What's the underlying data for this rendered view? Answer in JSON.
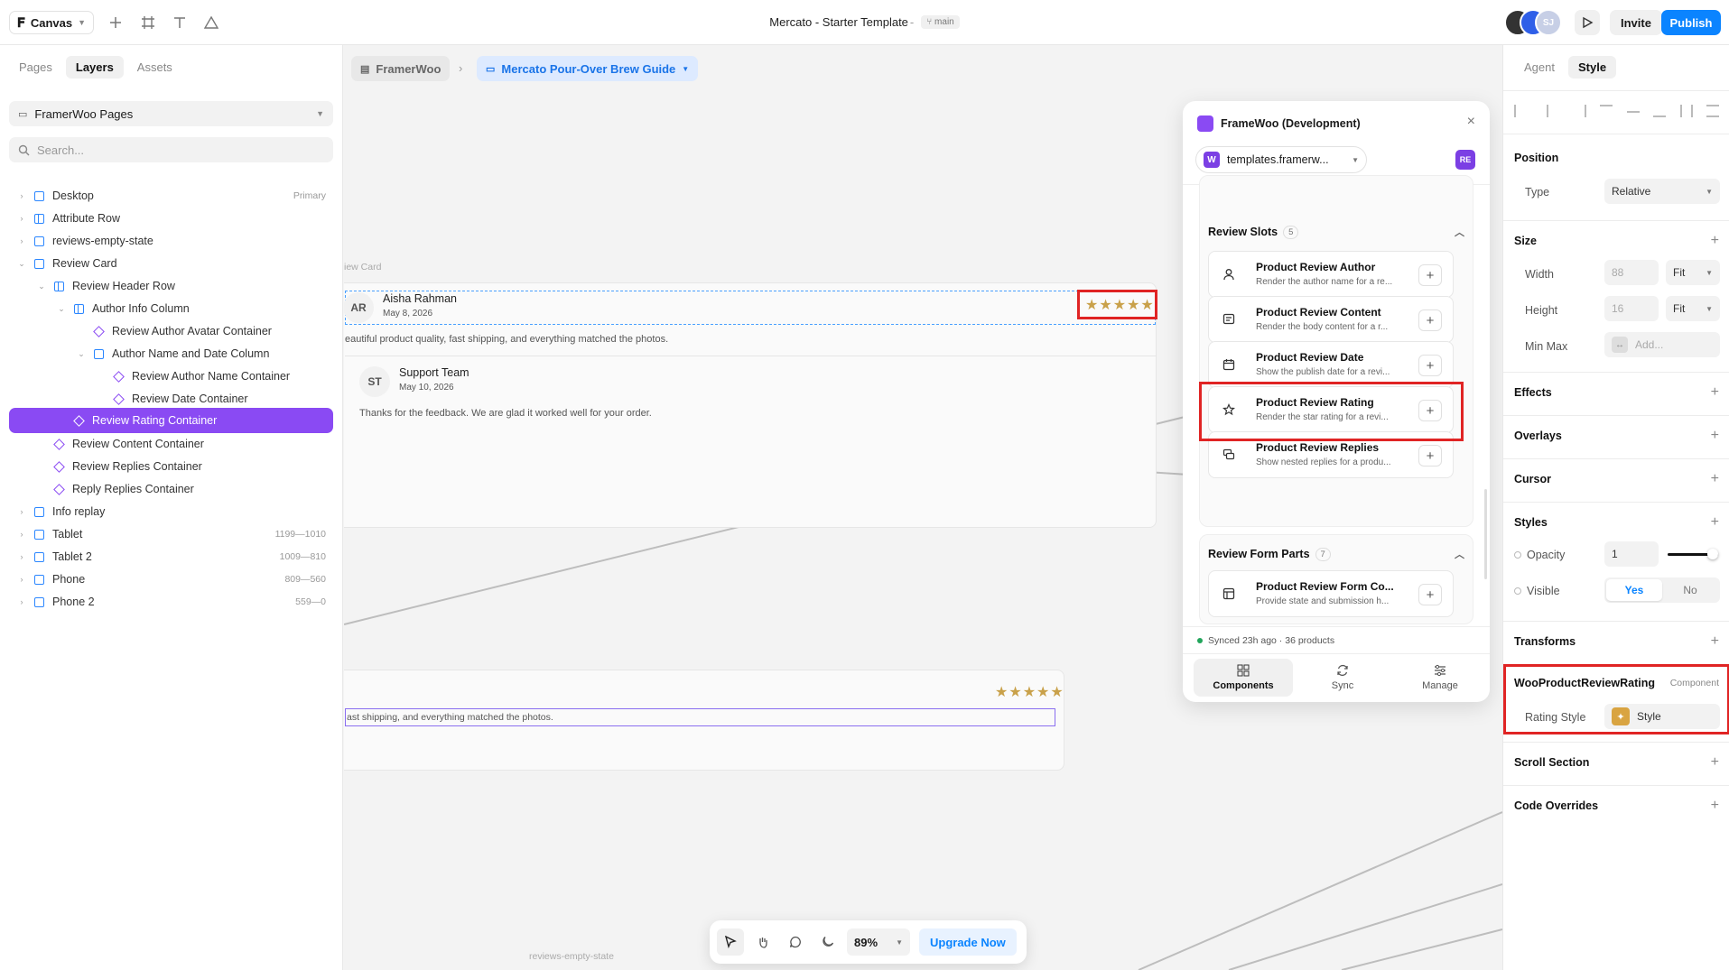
{
  "topbar": {
    "canvas_label": "Canvas",
    "title": "Mercato - Starter Template",
    "title_sep": "-",
    "branch": "main",
    "avatar_initials": "SJ",
    "invite_label": "Invite",
    "publish_label": "Publish"
  },
  "left_panel": {
    "tabs": [
      "Pages",
      "Layers",
      "Assets"
    ],
    "active_tab": "Layers",
    "page_selector": "FramerWoo Pages",
    "search_placeholder": "Search...",
    "layers": [
      {
        "label": "Desktop",
        "meta": "Primary"
      },
      {
        "label": "Attribute Row",
        "meta": ""
      },
      {
        "label": "reviews-empty-state",
        "meta": ""
      },
      {
        "label": "Review Card",
        "meta": ""
      },
      {
        "label": "Review Header Row",
        "meta": ""
      },
      {
        "label": "Author Info Column",
        "meta": ""
      },
      {
        "label": "Review Author Avatar Container",
        "meta": ""
      },
      {
        "label": "Author Name and Date Column",
        "meta": ""
      },
      {
        "label": "Review Author Name Container",
        "meta": ""
      },
      {
        "label": "Review Date Container",
        "meta": ""
      },
      {
        "label": "Review Rating Container",
        "meta": ""
      },
      {
        "label": "Review Content Container",
        "meta": ""
      },
      {
        "label": "Review Replies Container",
        "meta": ""
      },
      {
        "label": "Reply Replies Container",
        "meta": ""
      },
      {
        "label": "Info replay",
        "meta": ""
      },
      {
        "label": "Tablet",
        "meta": "1199—1010"
      },
      {
        "label": "Tablet 2",
        "meta": "1009—810"
      },
      {
        "label": "Phone",
        "meta": "809—560"
      },
      {
        "label": "Phone 2",
        "meta": "559—0"
      }
    ]
  },
  "canvas": {
    "breadcrumb_root": "FramerWoo",
    "breadcrumb_page": "Mercato Pour-Over Brew Guide",
    "card_label": "iew Card",
    "review": {
      "initials": "AR",
      "author": "Aisha Rahman",
      "date": "May 8, 2026",
      "content": "eautiful product quality, fast shipping, and everything matched the photos."
    },
    "reply": {
      "initials": "ST",
      "author": "Support Team",
      "date": "May 10, 2026",
      "content": "Thanks for the feedback. We are glad it worked well for your order."
    },
    "second_card_content": "ast shipping, and everything matched the photos.",
    "empty_state_label": "reviews-empty-state",
    "stars": "★★★★★"
  },
  "plugin": {
    "title": "FrameWoo (Development)",
    "site": "templates.framerw...",
    "site_badge": "W",
    "user_badge": "RE",
    "review_slots": {
      "title": "Review Slots",
      "count": "5",
      "items": [
        {
          "title": "Product Review Author",
          "desc": "Render the author name for a re..."
        },
        {
          "title": "Product Review Content",
          "desc": "Render the body content for a r..."
        },
        {
          "title": "Product Review Date",
          "desc": "Show the publish date for a revi..."
        },
        {
          "title": "Product Review Rating",
          "desc": "Render the star rating for a revi..."
        },
        {
          "title": "Product Review Replies",
          "desc": "Show nested replies for a produ..."
        }
      ]
    },
    "form_parts": {
      "title": "Review Form Parts",
      "count": "7",
      "items": [
        {
          "title": "Product Review Form Co...",
          "desc": "Provide state and submission h..."
        }
      ]
    },
    "sync_status": "Synced 23h ago · 36 products",
    "tabs": [
      "Components",
      "Sync",
      "Manage"
    ]
  },
  "right_panel": {
    "tabs": [
      "Agent",
      "Style"
    ],
    "active_tab": "Style",
    "position": {
      "title": "Position",
      "type_label": "Type",
      "type_value": "Relative"
    },
    "size": {
      "title": "Size",
      "width_label": "Width",
      "width_value": "88",
      "width_mode": "Fit",
      "height_label": "Height",
      "height_value": "16",
      "height_mode": "Fit",
      "minmax_label": "Min Max",
      "minmax_placeholder": "Add..."
    },
    "sections": [
      "Effects",
      "Overlays",
      "Cursor",
      "Styles"
    ],
    "opacity": {
      "label": "Opacity",
      "value": "1",
      "level": 1
    },
    "visible": {
      "label": "Visible",
      "yes": "Yes",
      "no": "No",
      "selected": "Yes"
    },
    "transforms": "Transforms",
    "component": {
      "name": "WooProductReviewRating",
      "kind": "Component",
      "prop_label": "Rating Style",
      "prop_value": "Style"
    },
    "scroll_section": "Scroll Section",
    "code_overrides": "Code Overrides"
  },
  "bottom_toolbar": {
    "zoom": "89%",
    "upgrade_label": "Upgrade Now"
  },
  "colors": {
    "accent": "#0b84ff",
    "selection": "#8a4af3",
    "highlight": "#e02424",
    "star": "#c9a14a"
  }
}
